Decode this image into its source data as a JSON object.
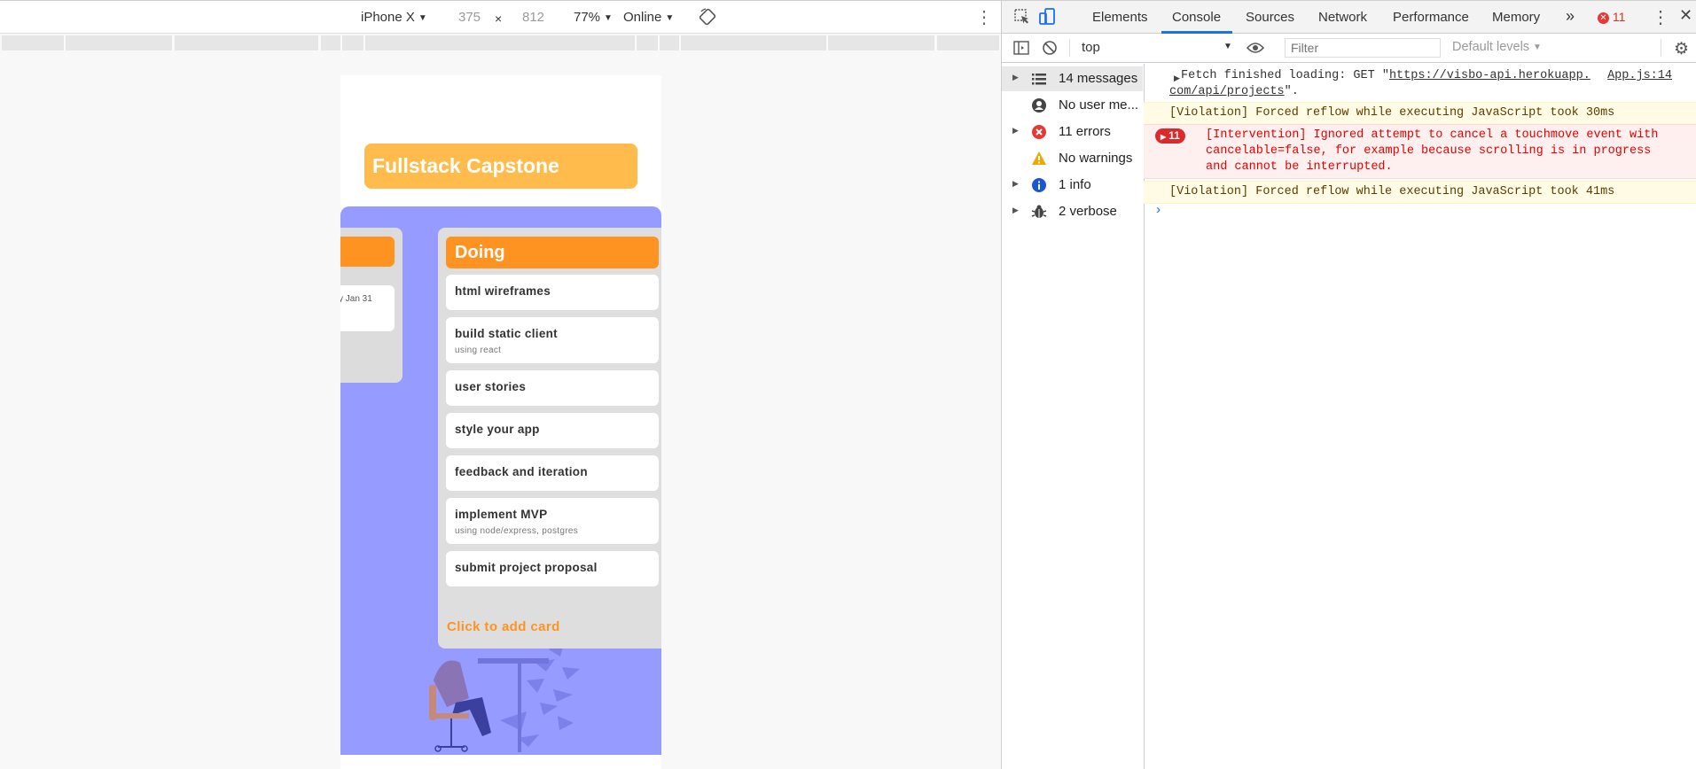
{
  "device_toolbar": {
    "device": "iPhone X",
    "width": "375",
    "times": "×",
    "height": "812",
    "zoom": "77%",
    "network": "Online"
  },
  "app": {
    "title": "Fullstack Capstone",
    "partial_list": {
      "card_meta": "y Jan 31"
    },
    "list": {
      "title": "Doing",
      "cards": [
        {
          "title": "html wireframes",
          "subtitle": ""
        },
        {
          "title": "build static client",
          "subtitle": "using react"
        },
        {
          "title": "user stories",
          "subtitle": ""
        },
        {
          "title": "style your app",
          "subtitle": ""
        },
        {
          "title": "feedback and iteration",
          "subtitle": ""
        },
        {
          "title": "implement MVP",
          "subtitle": "using node/express, postgres"
        },
        {
          "title": "submit project proposal",
          "subtitle": ""
        }
      ],
      "add_card": "Click to add card"
    }
  },
  "devtools": {
    "tabs": [
      "Elements",
      "Console",
      "Sources",
      "Network",
      "Performance",
      "Memory"
    ],
    "more": "»",
    "error_count": "11",
    "context": "top",
    "filter_placeholder": "Filter",
    "levels": "Default levels",
    "sidebar": [
      {
        "label": "14 messages",
        "icon": "list-icon"
      },
      {
        "label": "No user me...",
        "icon": "user-icon"
      },
      {
        "label": "11 errors",
        "icon": "error-icon"
      },
      {
        "label": "No warnings",
        "icon": "warning-icon"
      },
      {
        "label": "1 info",
        "icon": "info-icon"
      },
      {
        "label": "2 verbose",
        "icon": "bug-icon"
      }
    ],
    "messages": {
      "fetch_prefix": "Fetch finished loading: GET \"",
      "fetch_url_1": "https://visbo-api.herokuapp.",
      "fetch_url_2": "com/api/projects",
      "fetch_suffix": "\".",
      "fetch_source": "App.js:14",
      "violation_1": "[Violation] Forced reflow while executing JavaScript took 30ms",
      "error_badge": "11",
      "intervention_1": "[Intervention] Ignored attempt to cancel a touchmove event with",
      "intervention_2": "cancelable=false, for example because scrolling is in progress",
      "intervention_3": "and cannot be interrupted.",
      "violation_2": "[Violation] Forced reflow while executing JavaScript took 41ms",
      "prompt": "›"
    }
  },
  "colors": {
    "accent_orange": "#ff9322",
    "title_yellow": "#ffbb4b",
    "board_purple": "#959bff",
    "devtools_blue": "#1a73e8",
    "error_red": "#e50000"
  }
}
